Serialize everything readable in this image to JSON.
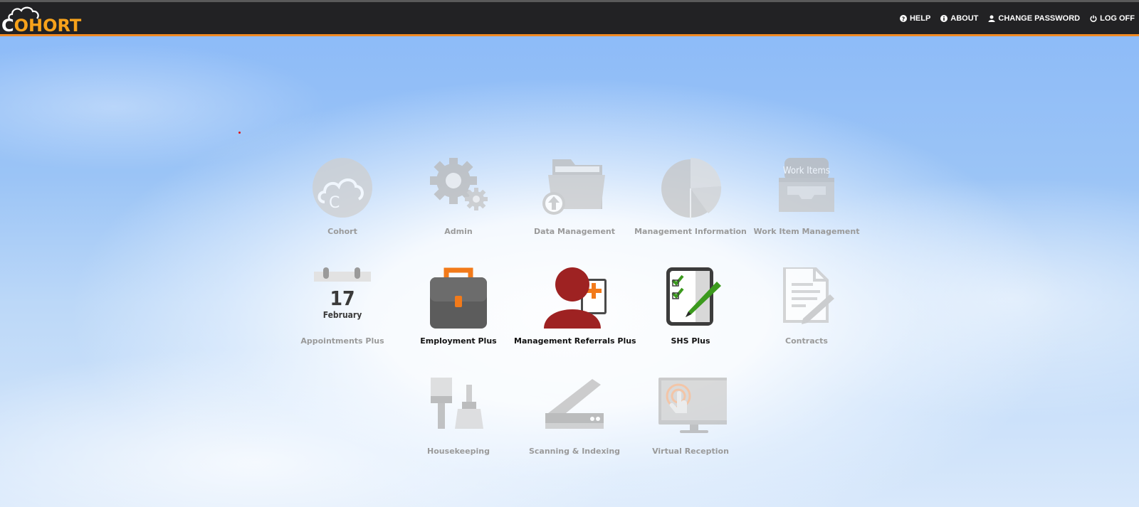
{
  "app": {
    "logo_text_c": "C",
    "logo_text_rest": "OHORT",
    "accent_color": "#f08a24",
    "brand_color": "#f7a21b"
  },
  "nav": [
    {
      "label": "HELP",
      "icon": "help-icon"
    },
    {
      "label": "ABOUT",
      "icon": "info-icon"
    },
    {
      "label": "CHANGE PASSWORD",
      "icon": "user-icon"
    },
    {
      "label": "LOG OFF",
      "icon": "power-icon"
    }
  ],
  "tiles": [
    {
      "label": "Cohort",
      "icon": "cohort-cloud-icon",
      "enabled": false
    },
    {
      "label": "Admin",
      "icon": "gears-icon",
      "enabled": false
    },
    {
      "label": "Data Management",
      "icon": "folder-upload-icon",
      "enabled": false
    },
    {
      "label": "Management Information",
      "icon": "pie-chart-icon",
      "enabled": false
    },
    {
      "label": "Work Item Management",
      "icon": "inbox-tray-icon",
      "enabled": false,
      "icon_text": "Work Items"
    },
    {
      "label": "Appointments Plus",
      "icon": "calendar-icon",
      "enabled": false,
      "day": "17",
      "month": "February"
    },
    {
      "label": "Employment Plus",
      "icon": "briefcase-icon",
      "enabled": true
    },
    {
      "label": "Management Referrals Plus",
      "icon": "person-referral-icon",
      "enabled": true
    },
    {
      "label": "SHS Plus",
      "icon": "checklist-pen-icon",
      "enabled": true
    },
    {
      "label": "Contracts",
      "icon": "document-pen-icon",
      "enabled": false
    },
    {
      "label": "Housekeeping",
      "icon": "brush-icon",
      "enabled": false
    },
    {
      "label": "Scanning & Indexing",
      "icon": "scanner-icon",
      "enabled": false
    },
    {
      "label": "Virtual Reception",
      "icon": "touch-screen-icon",
      "enabled": false
    }
  ]
}
